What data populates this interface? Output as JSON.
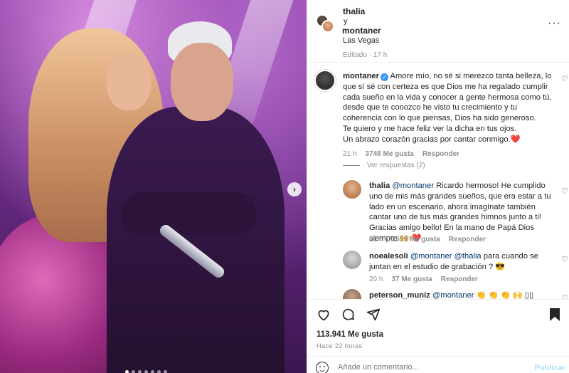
{
  "header": {
    "user1": "thalia",
    "conjunction": "y",
    "user2": "montaner",
    "location": "Las Vegas",
    "more_icon": "more-horizontal-icon"
  },
  "post": {
    "edited": "Editado · 17 h",
    "caption": {
      "author": "montaner",
      "text": "Amore mío, no sé si merezco tanta belleza, lo que sí sé con certeza es que Dios me ha regalado cumplir cada sueño en la vida y conocer a gente hermosa como tú, desde que te conozco he visto tu crecimiento y tu coherencia con lo que piensas, Dios ha sido generoso.",
      "text2": "Te quiero y me hace feliz ver la dicha en tus ojos.",
      "text3": "Un abrazo corazón gracias por cantar conmigo.❤️",
      "time": "21 h",
      "likes": "3748 Me gusta",
      "reply": "Responder"
    },
    "view_replies": "Ver respuestas (2)"
  },
  "comments": [
    {
      "author": "thalia",
      "mention": "@montaner",
      "text": "Ricardo hermoso! He cumplido uno de mis más grandes sueños, que era estar a tu lado en un escenario, ahora imagínate también cantar uno de tus más grandes himnos junto a ti! Gracias amigo bello! En la mano de Papá Dios siempre 🙌 ❤️",
      "time": "21 h",
      "likes": "2559 Me gusta",
      "reply": "Responder"
    },
    {
      "author": "noealesoli",
      "mention": "@montaner @thalia",
      "text": "para cuando se juntan en el estudio de grabación ? 😎",
      "time": "20 h",
      "likes": "37 Me gusta",
      "reply": "Responder"
    },
    {
      "author": "peterson_muniz",
      "mention": "@montaner",
      "text": "👏 👏 👏 🙌 ▯▯"
    }
  ],
  "actions": {
    "likes": "113.941 Me gusta",
    "when": "Hace 22 horas",
    "comment_placeholder": "Añade un comentario...",
    "publish": "Publicar"
  },
  "colors": {
    "link": "#00376b",
    "verified": "#3897f0",
    "muted": "#8e8e8e",
    "publish": "#b2dffc"
  }
}
